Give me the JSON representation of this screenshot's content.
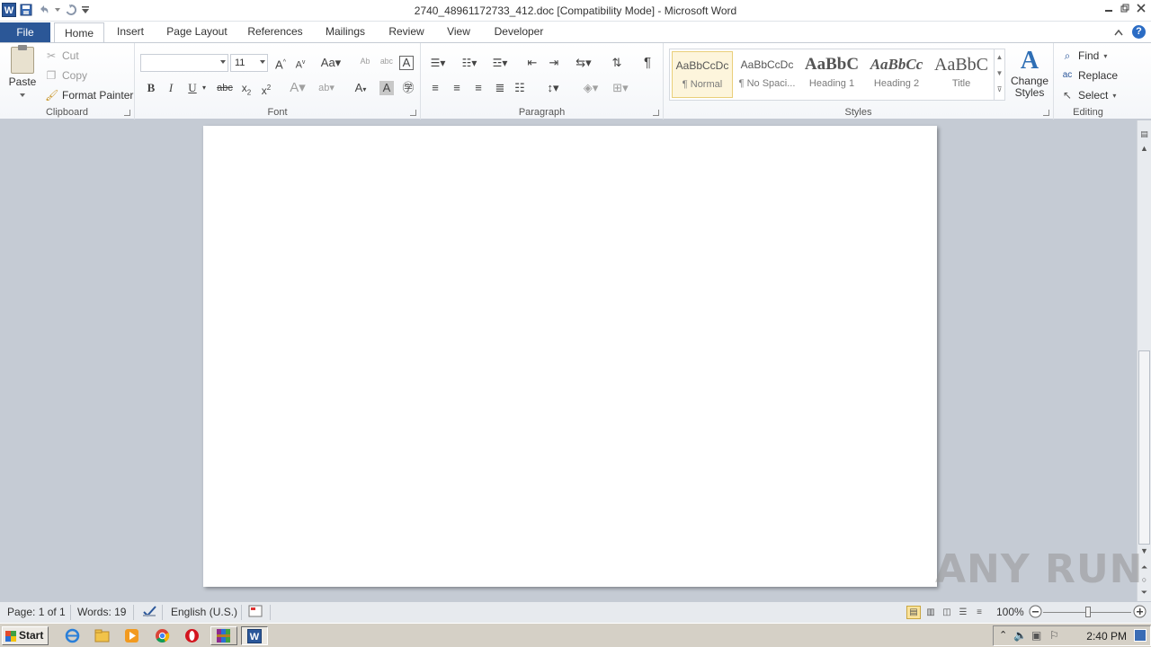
{
  "window": {
    "title": "2740_48961172733_412.doc [Compatibility Mode]  -  Microsoft Word"
  },
  "tabs": [
    {
      "label": "File"
    },
    {
      "label": "Home"
    },
    {
      "label": "Insert"
    },
    {
      "label": "Page Layout"
    },
    {
      "label": "References"
    },
    {
      "label": "Mailings"
    },
    {
      "label": "Review"
    },
    {
      "label": "View"
    },
    {
      "label": "Developer"
    }
  ],
  "clipboard": {
    "paste_label": "Paste",
    "cut_label": "Cut",
    "copy_label": "Copy",
    "format_painter_label": "Format Painter",
    "group_label": "Clipboard"
  },
  "font": {
    "font_name": "",
    "font_size": "11",
    "group_label": "Font"
  },
  "paragraph": {
    "group_label": "Paragraph"
  },
  "styles": {
    "items": [
      {
        "preview": "AaBbCcDc",
        "name": "¶ Normal"
      },
      {
        "preview": "AaBbCcDc",
        "name": "¶ No Spaci..."
      },
      {
        "preview": "AaBbC",
        "name": "Heading 1"
      },
      {
        "preview": "AaBbCc",
        "name": "Heading 2"
      },
      {
        "preview": "AaBbC",
        "name": "Title"
      }
    ],
    "change_styles_label": "Change Styles",
    "group_label": "Styles"
  },
  "editing": {
    "find_label": "Find",
    "replace_label": "Replace",
    "select_label": "Select",
    "group_label": "Editing"
  },
  "statusbar": {
    "page": "Page: 1 of 1",
    "words": "Words: 19",
    "language": "English (U.S.)",
    "zoom": "100%",
    "zoom_level_percent": 100
  },
  "taskbar": {
    "start_label": "Start",
    "clock": "2:40 PM"
  },
  "watermark": "ANY RUN",
  "colors": {
    "file_tab": "#2b5797",
    "accent": "#2b579a",
    "doc_background": "#c5cbd4"
  }
}
